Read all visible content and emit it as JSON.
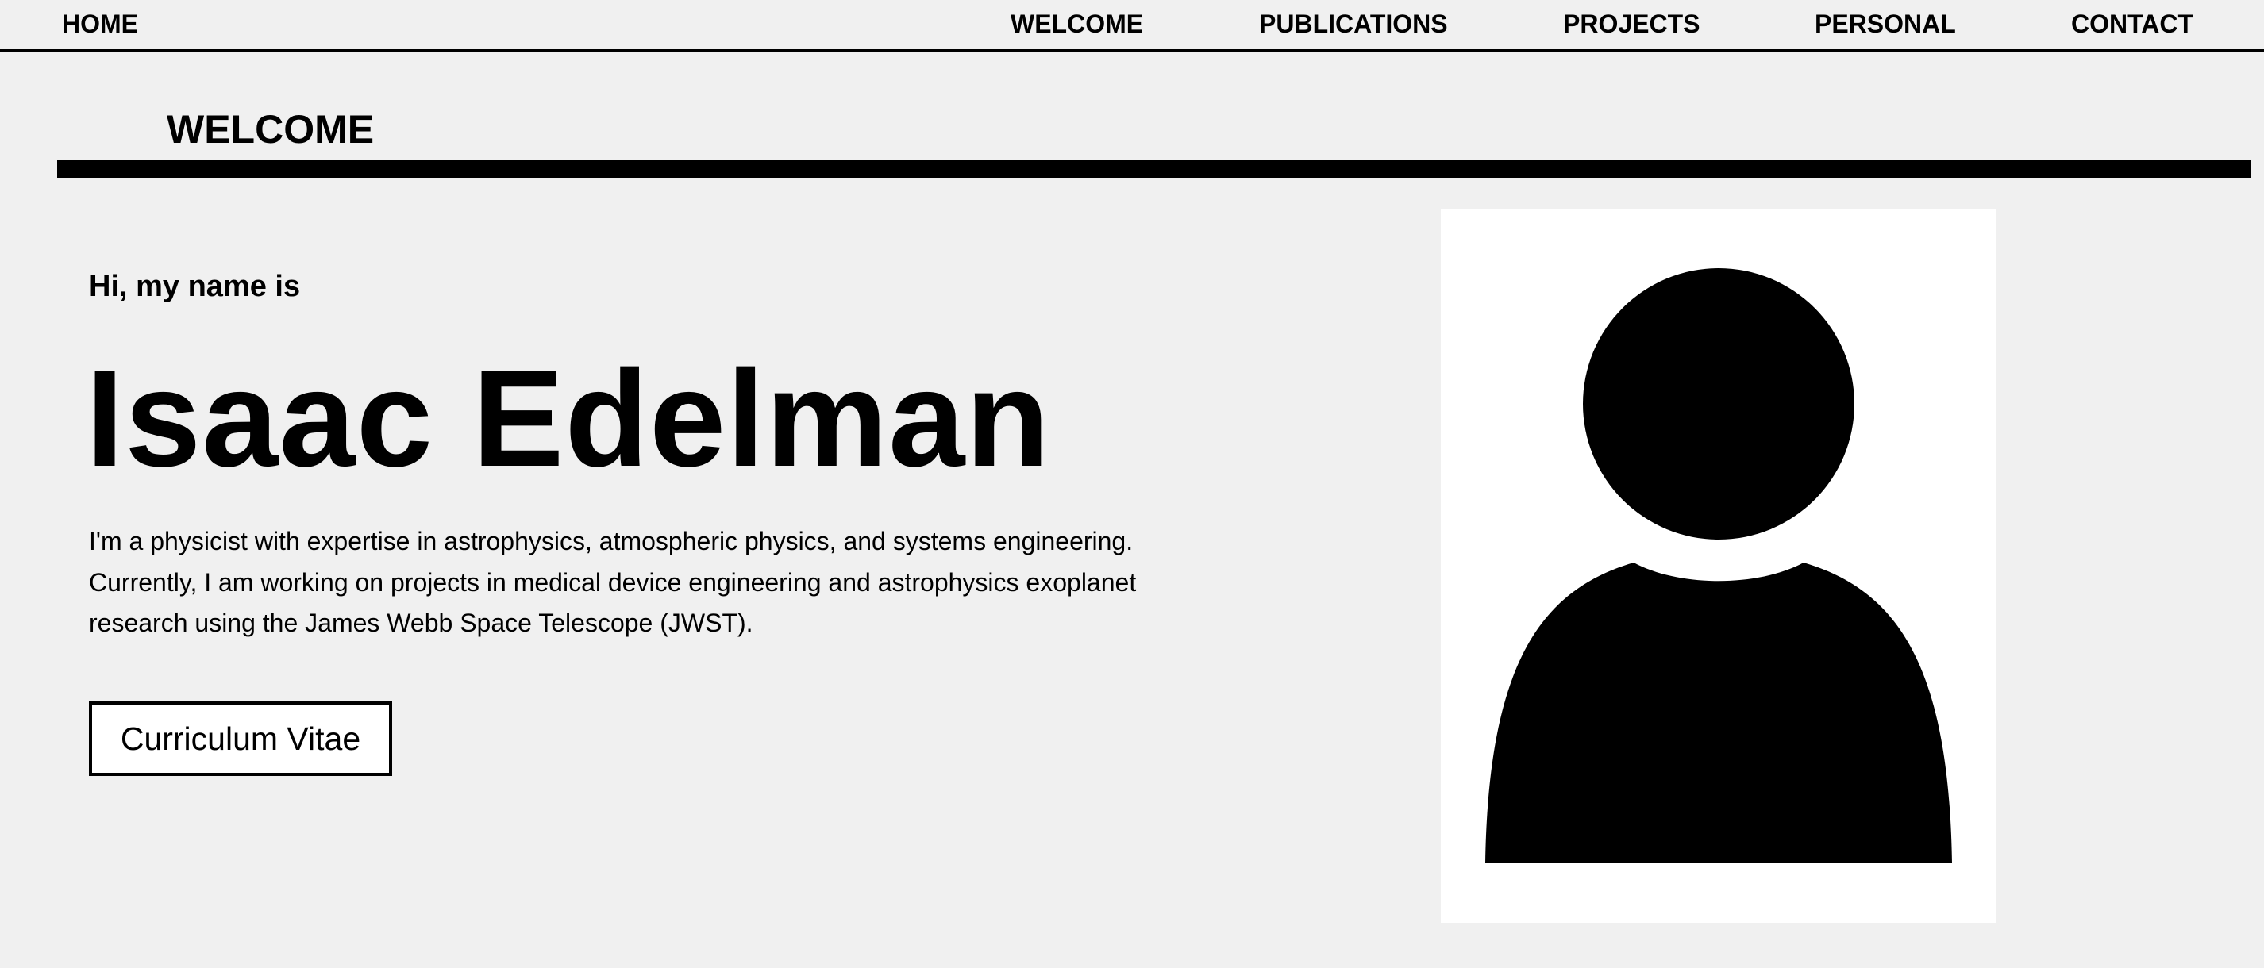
{
  "nav": {
    "home": "HOME",
    "items": [
      "WELCOME",
      "PUBLICATIONS",
      "PROJECTS",
      "PERSONAL",
      "CONTACT"
    ]
  },
  "section": {
    "heading": "WELCOME"
  },
  "intro": {
    "greeting": "Hi, my name is",
    "name": "Isaac Edelman",
    "bio": "I'm a physicist with expertise in astrophysics, atmospheric physics, and systems engineering. Currently, I am working on projects in medical device engineering and astrophysics exoplanet research using the James Webb Space Telescope (JWST)."
  },
  "actions": {
    "cv_label": "Curriculum Vitae"
  },
  "portrait": {
    "icon": "person-silhouette-icon"
  }
}
